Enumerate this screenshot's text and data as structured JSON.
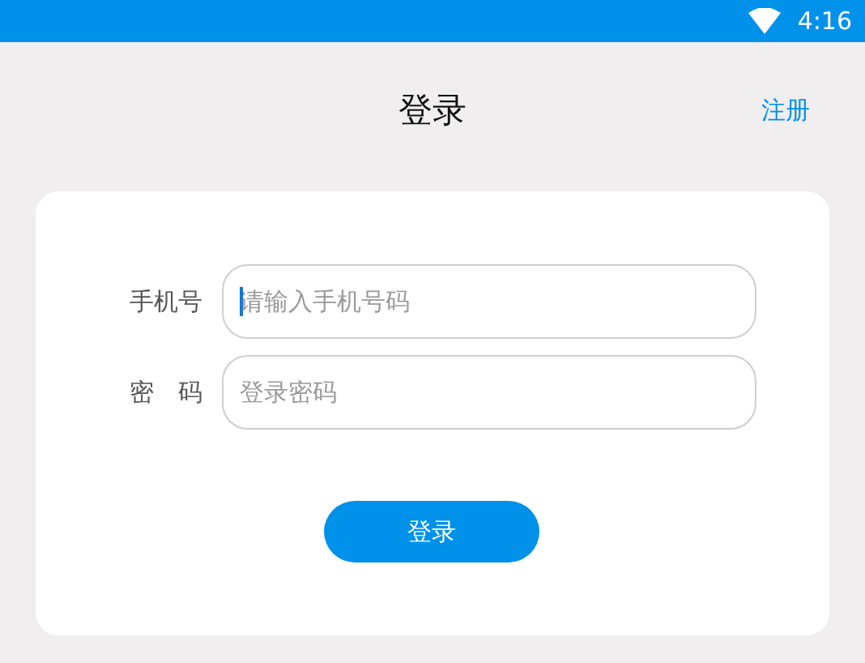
{
  "status_bar": {
    "time": "4:16"
  },
  "header": {
    "title": "登录",
    "action": "注册"
  },
  "form": {
    "fields": [
      {
        "label": "手机号",
        "placeholder": "请输入手机号码",
        "focused": true
      },
      {
        "label": "密　码",
        "placeholder": "登录密码",
        "focused": false
      }
    ],
    "submit": "登录"
  }
}
